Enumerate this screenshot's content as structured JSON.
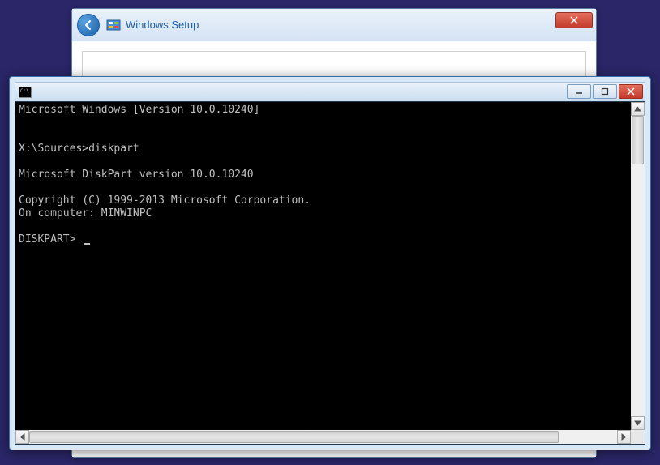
{
  "setup_window": {
    "title": "Windows Setup"
  },
  "cmd_window": {
    "title": "",
    "lines": {
      "l0": "Microsoft Windows [Version 10.0.10240]",
      "l1": "",
      "l2": "",
      "l3": "X:\\Sources>diskpart",
      "l4": "",
      "l5": "Microsoft DiskPart version 10.0.10240",
      "l6": "",
      "l7": "Copyright (C) 1999-2013 Microsoft Corporation.",
      "l8": "On computer: MINWINPC",
      "l9": "",
      "l10": "DISKPART> "
    }
  }
}
